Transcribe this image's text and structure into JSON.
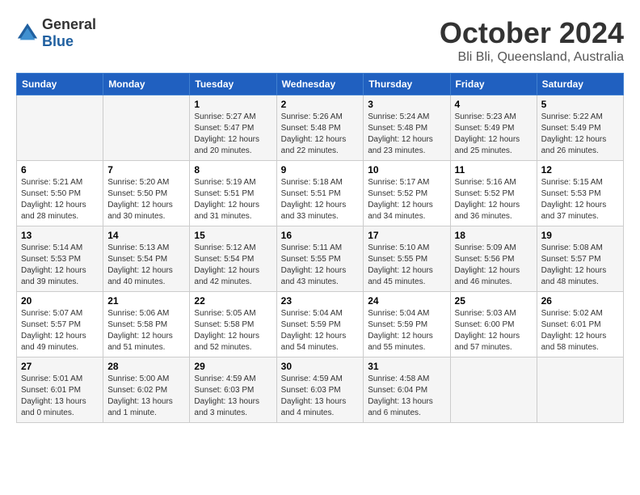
{
  "logo": {
    "general": "General",
    "blue": "Blue"
  },
  "title": "October 2024",
  "location": "Bli Bli, Queensland, Australia",
  "weekdays": [
    "Sunday",
    "Monday",
    "Tuesday",
    "Wednesday",
    "Thursday",
    "Friday",
    "Saturday"
  ],
  "weeks": [
    [
      {
        "day": "",
        "sunrise": "",
        "sunset": "",
        "daylight": ""
      },
      {
        "day": "",
        "sunrise": "",
        "sunset": "",
        "daylight": ""
      },
      {
        "day": "1",
        "sunrise": "Sunrise: 5:27 AM",
        "sunset": "Sunset: 5:47 PM",
        "daylight": "Daylight: 12 hours and 20 minutes."
      },
      {
        "day": "2",
        "sunrise": "Sunrise: 5:26 AM",
        "sunset": "Sunset: 5:48 PM",
        "daylight": "Daylight: 12 hours and 22 minutes."
      },
      {
        "day": "3",
        "sunrise": "Sunrise: 5:24 AM",
        "sunset": "Sunset: 5:48 PM",
        "daylight": "Daylight: 12 hours and 23 minutes."
      },
      {
        "day": "4",
        "sunrise": "Sunrise: 5:23 AM",
        "sunset": "Sunset: 5:49 PM",
        "daylight": "Daylight: 12 hours and 25 minutes."
      },
      {
        "day": "5",
        "sunrise": "Sunrise: 5:22 AM",
        "sunset": "Sunset: 5:49 PM",
        "daylight": "Daylight: 12 hours and 26 minutes."
      }
    ],
    [
      {
        "day": "6",
        "sunrise": "Sunrise: 5:21 AM",
        "sunset": "Sunset: 5:50 PM",
        "daylight": "Daylight: 12 hours and 28 minutes."
      },
      {
        "day": "7",
        "sunrise": "Sunrise: 5:20 AM",
        "sunset": "Sunset: 5:50 PM",
        "daylight": "Daylight: 12 hours and 30 minutes."
      },
      {
        "day": "8",
        "sunrise": "Sunrise: 5:19 AM",
        "sunset": "Sunset: 5:51 PM",
        "daylight": "Daylight: 12 hours and 31 minutes."
      },
      {
        "day": "9",
        "sunrise": "Sunrise: 5:18 AM",
        "sunset": "Sunset: 5:51 PM",
        "daylight": "Daylight: 12 hours and 33 minutes."
      },
      {
        "day": "10",
        "sunrise": "Sunrise: 5:17 AM",
        "sunset": "Sunset: 5:52 PM",
        "daylight": "Daylight: 12 hours and 34 minutes."
      },
      {
        "day": "11",
        "sunrise": "Sunrise: 5:16 AM",
        "sunset": "Sunset: 5:52 PM",
        "daylight": "Daylight: 12 hours and 36 minutes."
      },
      {
        "day": "12",
        "sunrise": "Sunrise: 5:15 AM",
        "sunset": "Sunset: 5:53 PM",
        "daylight": "Daylight: 12 hours and 37 minutes."
      }
    ],
    [
      {
        "day": "13",
        "sunrise": "Sunrise: 5:14 AM",
        "sunset": "Sunset: 5:53 PM",
        "daylight": "Daylight: 12 hours and 39 minutes."
      },
      {
        "day": "14",
        "sunrise": "Sunrise: 5:13 AM",
        "sunset": "Sunset: 5:54 PM",
        "daylight": "Daylight: 12 hours and 40 minutes."
      },
      {
        "day": "15",
        "sunrise": "Sunrise: 5:12 AM",
        "sunset": "Sunset: 5:54 PM",
        "daylight": "Daylight: 12 hours and 42 minutes."
      },
      {
        "day": "16",
        "sunrise": "Sunrise: 5:11 AM",
        "sunset": "Sunset: 5:55 PM",
        "daylight": "Daylight: 12 hours and 43 minutes."
      },
      {
        "day": "17",
        "sunrise": "Sunrise: 5:10 AM",
        "sunset": "Sunset: 5:55 PM",
        "daylight": "Daylight: 12 hours and 45 minutes."
      },
      {
        "day": "18",
        "sunrise": "Sunrise: 5:09 AM",
        "sunset": "Sunset: 5:56 PM",
        "daylight": "Daylight: 12 hours and 46 minutes."
      },
      {
        "day": "19",
        "sunrise": "Sunrise: 5:08 AM",
        "sunset": "Sunset: 5:57 PM",
        "daylight": "Daylight: 12 hours and 48 minutes."
      }
    ],
    [
      {
        "day": "20",
        "sunrise": "Sunrise: 5:07 AM",
        "sunset": "Sunset: 5:57 PM",
        "daylight": "Daylight: 12 hours and 49 minutes."
      },
      {
        "day": "21",
        "sunrise": "Sunrise: 5:06 AM",
        "sunset": "Sunset: 5:58 PM",
        "daylight": "Daylight: 12 hours and 51 minutes."
      },
      {
        "day": "22",
        "sunrise": "Sunrise: 5:05 AM",
        "sunset": "Sunset: 5:58 PM",
        "daylight": "Daylight: 12 hours and 52 minutes."
      },
      {
        "day": "23",
        "sunrise": "Sunrise: 5:04 AM",
        "sunset": "Sunset: 5:59 PM",
        "daylight": "Daylight: 12 hours and 54 minutes."
      },
      {
        "day": "24",
        "sunrise": "Sunrise: 5:04 AM",
        "sunset": "Sunset: 5:59 PM",
        "daylight": "Daylight: 12 hours and 55 minutes."
      },
      {
        "day": "25",
        "sunrise": "Sunrise: 5:03 AM",
        "sunset": "Sunset: 6:00 PM",
        "daylight": "Daylight: 12 hours and 57 minutes."
      },
      {
        "day": "26",
        "sunrise": "Sunrise: 5:02 AM",
        "sunset": "Sunset: 6:01 PM",
        "daylight": "Daylight: 12 hours and 58 minutes."
      }
    ],
    [
      {
        "day": "27",
        "sunrise": "Sunrise: 5:01 AM",
        "sunset": "Sunset: 6:01 PM",
        "daylight": "Daylight: 13 hours and 0 minutes."
      },
      {
        "day": "28",
        "sunrise": "Sunrise: 5:00 AM",
        "sunset": "Sunset: 6:02 PM",
        "daylight": "Daylight: 13 hours and 1 minute."
      },
      {
        "day": "29",
        "sunrise": "Sunrise: 4:59 AM",
        "sunset": "Sunset: 6:03 PM",
        "daylight": "Daylight: 13 hours and 3 minutes."
      },
      {
        "day": "30",
        "sunrise": "Sunrise: 4:59 AM",
        "sunset": "Sunset: 6:03 PM",
        "daylight": "Daylight: 13 hours and 4 minutes."
      },
      {
        "day": "31",
        "sunrise": "Sunrise: 4:58 AM",
        "sunset": "Sunset: 6:04 PM",
        "daylight": "Daylight: 13 hours and 6 minutes."
      },
      {
        "day": "",
        "sunrise": "",
        "sunset": "",
        "daylight": ""
      },
      {
        "day": "",
        "sunrise": "",
        "sunset": "",
        "daylight": ""
      }
    ]
  ]
}
